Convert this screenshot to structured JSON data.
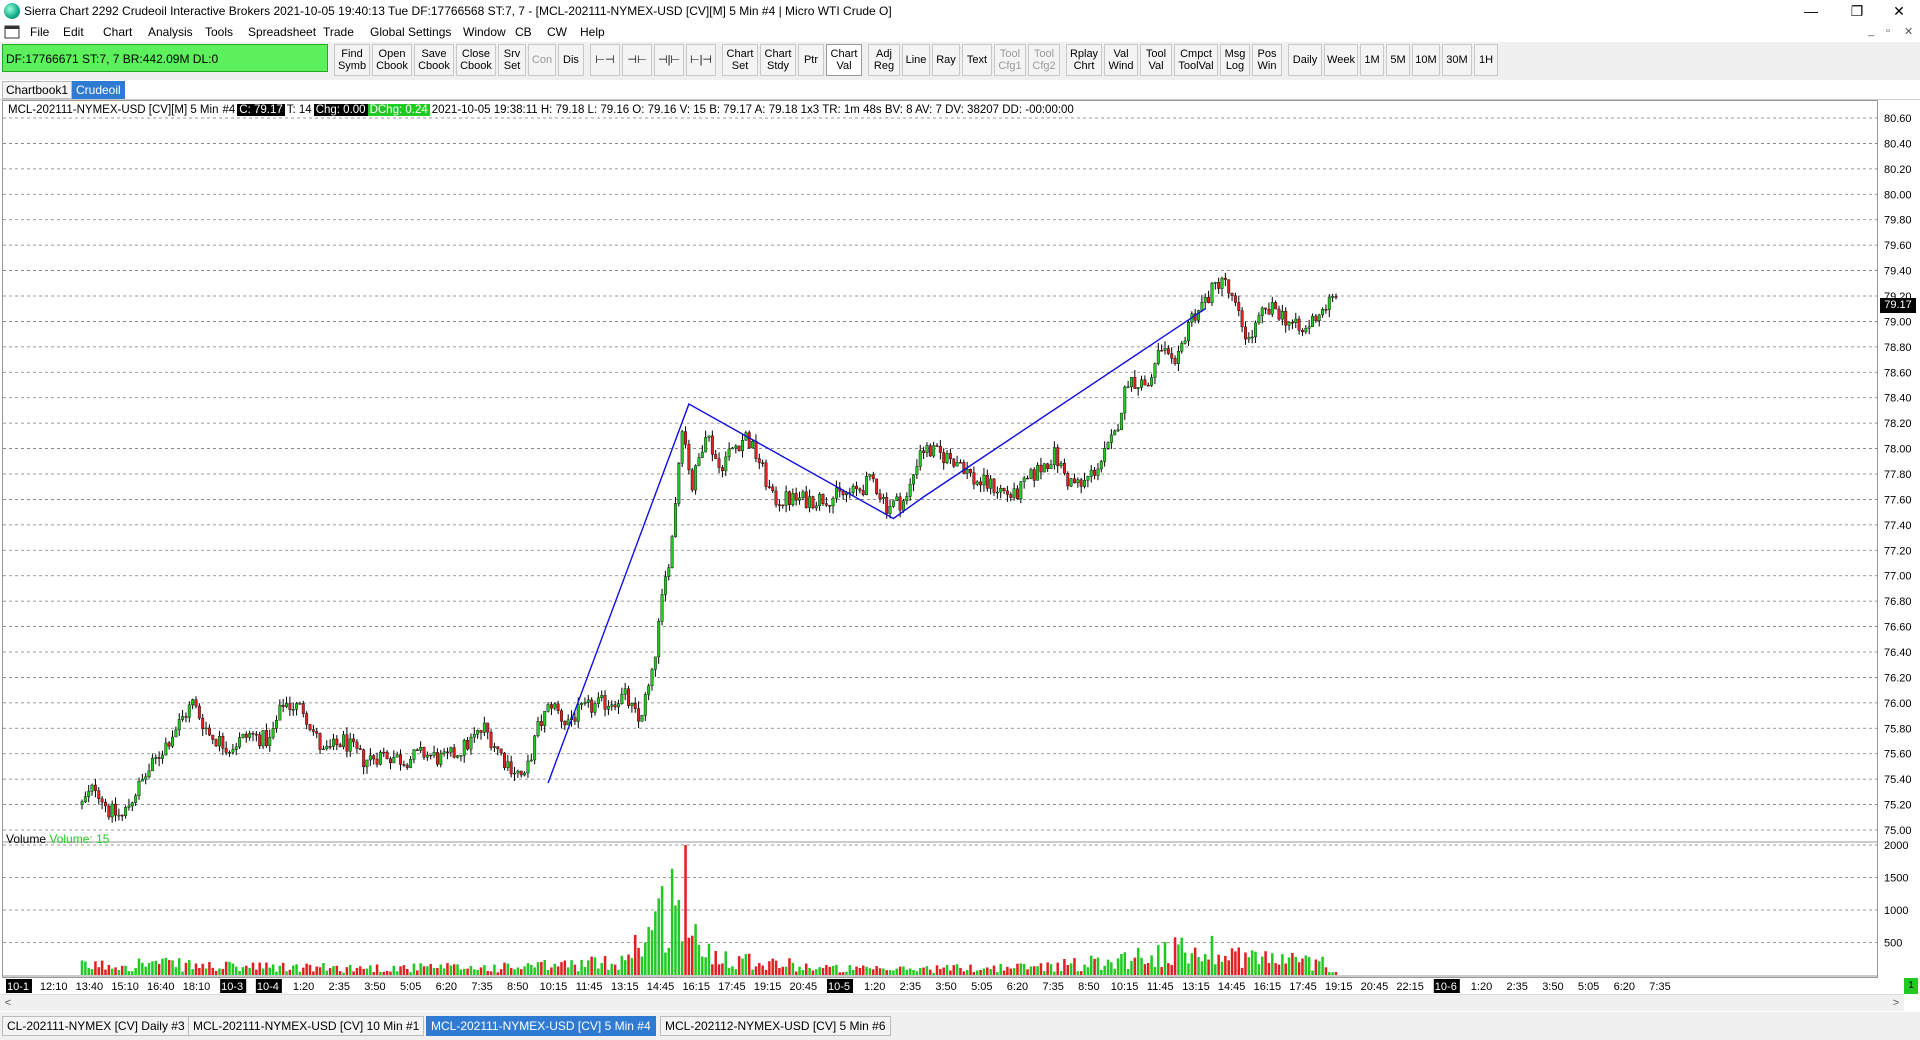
{
  "window": {
    "title": "Sierra Chart 2292 Crudeoil  Interactive Brokers 2021-10-05  19:40:13 Tue  DF:17766568  ST:7, 7 - [MCL-202111-NYMEX-USD [CV][M]  5 Min  #4 | Micro WTI Crude O]",
    "min": "—",
    "restore": "❐",
    "close": "✕"
  },
  "menu": [
    "File",
    "Edit",
    "Chart",
    "Analysis",
    "Tools",
    "Spreadsheet",
    "Trade",
    "Global Settings",
    "Window",
    "CB",
    "CW",
    "Help"
  ],
  "mdi_controls": [
    "_",
    "▫",
    "✕"
  ],
  "status": "DF:17766671  ST:7, 7  BR:442.09M  DL:0",
  "toolbar": [
    {
      "label": "Find\nSymb"
    },
    {
      "label": "Open\nCbook"
    },
    {
      "label": "Save\nCbook"
    },
    {
      "label": "Close\nCbook"
    },
    {
      "label": "Srv\nSet"
    },
    {
      "label": "Con",
      "disabled": true
    },
    {
      "label": "Dis"
    },
    {
      "label": "⊢⊣"
    },
    {
      "label": "⊣⊢"
    },
    {
      "label": "⊣|⊢"
    },
    {
      "label": "⊢|⊣"
    },
    {
      "label": "Chart\nSet"
    },
    {
      "label": "Chart\nStdy"
    },
    {
      "label": "Ptr"
    },
    {
      "label": "Chart\nVal",
      "pressed": true
    },
    {
      "label": "Adj\nReg"
    },
    {
      "label": "Line"
    },
    {
      "label": "Ray"
    },
    {
      "label": "Text"
    },
    {
      "label": "Tool\nCfg1",
      "disabled": true
    },
    {
      "label": "Tool\nCfg2",
      "disabled": true
    },
    {
      "label": "Rplay\nChrt"
    },
    {
      "label": "Val\nWind"
    },
    {
      "label": "Tool\nVal"
    },
    {
      "label": "Cmpct\nToolVal"
    },
    {
      "label": "Msg\nLog"
    },
    {
      "label": "Pos\nWin"
    },
    {
      "label": "Daily"
    },
    {
      "label": "Week"
    },
    {
      "label": "1M"
    },
    {
      "label": "5M"
    },
    {
      "label": "10M"
    },
    {
      "label": "30M"
    },
    {
      "label": "1H"
    }
  ],
  "chartbook_tabs": [
    {
      "label": "Chartbook1",
      "active": false
    },
    {
      "label": "Crudeoil",
      "active": true
    }
  ],
  "chart_header": {
    "symbol": "MCL-202111-NYMEX-USD [CV][M]  5 Min",
    "num": "#4",
    "close": "C: 79.17",
    "trades": "T: 14",
    "chg": "Chg: 0.00",
    "dchg": "DChg: 0.24",
    "rest": "2021-10-05 19:38:11  H: 79.18  L: 79.16  O: 79.16  V: 15  B: 79.17  A: 79.18  1x3  TR: 1m 48s  BV: 8  AV: 7  DV: 38207  DD: -00:00:00"
  },
  "volume_label": {
    "name": "Volume",
    "value": "Volume: 15"
  },
  "last_price": "79.17",
  "scroll_badge": "1",
  "bottom_tabs": [
    {
      "label": "CL-202111-NYMEX [CV]  Daily  #3",
      "active": false
    },
    {
      "label": "MCL-202111-NYMEX-USD [CV]  10 Min  #1",
      "active": false
    },
    {
      "label": "MCL-202111-NYMEX-USD [CV]  5 Min  #4",
      "active": true
    },
    {
      "label": "MCL-202112-NYMEX-USD [CV]  5 Min  #6",
      "active": false
    }
  ],
  "colors": {
    "up": "#22c922",
    "down": "#e02020",
    "wick": "#000000",
    "trendline": "#1010e0"
  },
  "chart_data": {
    "type": "candlestick",
    "price_axis": {
      "min": 75.0,
      "max": 80.6,
      "ticks": [
        "80.60",
        "80.40",
        "80.20",
        "80.00",
        "79.80",
        "79.60",
        "79.40",
        "79.20",
        "79.00",
        "78.80",
        "78.60",
        "78.40",
        "78.20",
        "78.00",
        "77.80",
        "77.60",
        "77.40",
        "77.20",
        "77.00",
        "76.80",
        "76.60",
        "76.40",
        "76.20",
        "76.00",
        "75.80",
        "75.60",
        "75.40",
        "75.20",
        "75.00"
      ]
    },
    "volume_axis": {
      "max": 2000,
      "ticks": [
        "2000",
        "1500",
        "1000",
        "500"
      ]
    },
    "time_ticks": [
      {
        "label": "10-1",
        "hl": true
      },
      {
        "label": "12:10"
      },
      {
        "label": "13:40"
      },
      {
        "label": "15:10"
      },
      {
        "label": "16:40"
      },
      {
        "label": "18:10"
      },
      {
        "label": "10-3",
        "hl": true
      },
      {
        "label": "10-4",
        "hl": true
      },
      {
        "label": "1:20"
      },
      {
        "label": "2:35"
      },
      {
        "label": "3:50"
      },
      {
        "label": "5:05"
      },
      {
        "label": "6:20"
      },
      {
        "label": "7:35"
      },
      {
        "label": "8:50"
      },
      {
        "label": "10:15"
      },
      {
        "label": "11:45"
      },
      {
        "label": "13:15"
      },
      {
        "label": "14:45"
      },
      {
        "label": "16:15"
      },
      {
        "label": "17:45"
      },
      {
        "label": "19:15"
      },
      {
        "label": "20:45"
      },
      {
        "label": "10-5",
        "hl": true
      },
      {
        "label": "1:20"
      },
      {
        "label": "2:35"
      },
      {
        "label": "3:50"
      },
      {
        "label": "5:05"
      },
      {
        "label": "6:20"
      },
      {
        "label": "7:35"
      },
      {
        "label": "8:50"
      },
      {
        "label": "10:15"
      },
      {
        "label": "11:45"
      },
      {
        "label": "13:15"
      },
      {
        "label": "14:45"
      },
      {
        "label": "16:15"
      },
      {
        "label": "17:45"
      },
      {
        "label": "19:15"
      },
      {
        "label": "20:45"
      },
      {
        "label": "22:15"
      },
      {
        "label": "10-6",
        "hl": true
      },
      {
        "label": "1:20"
      },
      {
        "label": "2:35"
      },
      {
        "label": "3:50"
      },
      {
        "label": "5:05"
      },
      {
        "label": "6:20"
      },
      {
        "label": "7:35"
      }
    ],
    "anchors": [
      {
        "i": 0,
        "p": 75.2
      },
      {
        "i": 4,
        "p": 75.35
      },
      {
        "i": 8,
        "p": 75.15
      },
      {
        "i": 12,
        "p": 75.1
      },
      {
        "i": 16,
        "p": 75.3
      },
      {
        "i": 22,
        "p": 75.55
      },
      {
        "i": 28,
        "p": 75.8
      },
      {
        "i": 33,
        "p": 76.0
      },
      {
        "i": 38,
        "p": 75.75
      },
      {
        "i": 44,
        "p": 75.65
      },
      {
        "i": 50,
        "p": 75.75
      },
      {
        "i": 56,
        "p": 75.7
      },
      {
        "i": 60,
        "p": 76.0
      },
      {
        "i": 66,
        "p": 75.95
      },
      {
        "i": 72,
        "p": 75.6
      },
      {
        "i": 78,
        "p": 75.7
      },
      {
        "i": 84,
        "p": 75.55
      },
      {
        "i": 90,
        "p": 75.6
      },
      {
        "i": 96,
        "p": 75.55
      },
      {
        "i": 102,
        "p": 75.6
      },
      {
        "i": 108,
        "p": 75.55
      },
      {
        "i": 114,
        "p": 75.65
      },
      {
        "i": 120,
        "p": 75.8
      },
      {
        "i": 126,
        "p": 75.55
      },
      {
        "i": 132,
        "p": 75.4
      },
      {
        "i": 136,
        "p": 75.8
      },
      {
        "i": 140,
        "p": 76.0
      },
      {
        "i": 144,
        "p": 75.85
      },
      {
        "i": 150,
        "p": 75.95
      },
      {
        "i": 156,
        "p": 76.0
      },
      {
        "i": 162,
        "p": 76.05
      },
      {
        "i": 166,
        "p": 75.85
      },
      {
        "i": 170,
        "p": 76.2
      },
      {
        "i": 173,
        "p": 76.8
      },
      {
        "i": 176,
        "p": 77.3
      },
      {
        "i": 179,
        "p": 78.2
      },
      {
        "i": 182,
        "p": 77.7
      },
      {
        "i": 186,
        "p": 78.15
      },
      {
        "i": 190,
        "p": 77.85
      },
      {
        "i": 194,
        "p": 78.0
      },
      {
        "i": 198,
        "p": 78.1
      },
      {
        "i": 202,
        "p": 77.9
      },
      {
        "i": 206,
        "p": 77.6
      },
      {
        "i": 212,
        "p": 77.6
      },
      {
        "i": 218,
        "p": 77.6
      },
      {
        "i": 224,
        "p": 77.62
      },
      {
        "i": 230,
        "p": 77.65
      },
      {
        "i": 236,
        "p": 77.75
      },
      {
        "i": 240,
        "p": 77.55
      },
      {
        "i": 246,
        "p": 77.6
      },
      {
        "i": 250,
        "p": 78.0
      },
      {
        "i": 256,
        "p": 77.95
      },
      {
        "i": 262,
        "p": 77.9
      },
      {
        "i": 266,
        "p": 77.75
      },
      {
        "i": 272,
        "p": 77.7
      },
      {
        "i": 278,
        "p": 77.62
      },
      {
        "i": 284,
        "p": 77.8
      },
      {
        "i": 290,
        "p": 77.95
      },
      {
        "i": 294,
        "p": 77.75
      },
      {
        "i": 298,
        "p": 77.7
      },
      {
        "i": 304,
        "p": 77.9
      },
      {
        "i": 308,
        "p": 78.1
      },
      {
        "i": 312,
        "p": 78.55
      },
      {
        "i": 318,
        "p": 78.5
      },
      {
        "i": 322,
        "p": 78.8
      },
      {
        "i": 326,
        "p": 78.6
      },
      {
        "i": 330,
        "p": 79.0
      },
      {
        "i": 336,
        "p": 79.2
      },
      {
        "i": 340,
        "p": 79.35
      },
      {
        "i": 344,
        "p": 79.1
      },
      {
        "i": 348,
        "p": 78.85
      },
      {
        "i": 352,
        "p": 79.05
      },
      {
        "i": 356,
        "p": 79.1
      },
      {
        "i": 360,
        "p": 79.0
      },
      {
        "i": 364,
        "p": 78.9
      },
      {
        "i": 368,
        "p": 79.05
      },
      {
        "i": 372,
        "p": 79.15
      },
      {
        "i": 374,
        "p": 79.17
      }
    ],
    "volume_profile": [
      {
        "i": 0,
        "v": 150
      },
      {
        "i": 20,
        "v": 200
      },
      {
        "i": 40,
        "v": 140
      },
      {
        "i": 80,
        "v": 120
      },
      {
        "i": 130,
        "v": 130
      },
      {
        "i": 160,
        "v": 220
      },
      {
        "i": 172,
        "v": 900
      },
      {
        "i": 176,
        "v": 1300
      },
      {
        "i": 180,
        "v": 700
      },
      {
        "i": 186,
        "v": 400
      },
      {
        "i": 200,
        "v": 250
      },
      {
        "i": 220,
        "v": 120
      },
      {
        "i": 240,
        "v": 90
      },
      {
        "i": 250,
        "v": 110
      },
      {
        "i": 280,
        "v": 130
      },
      {
        "i": 300,
        "v": 200
      },
      {
        "i": 320,
        "v": 350
      },
      {
        "i": 336,
        "v": 450
      },
      {
        "i": 350,
        "v": 300
      },
      {
        "i": 370,
        "v": 200
      },
      {
        "i": 374,
        "v": 80
      }
    ],
    "volume_spike": {
      "i": 180,
      "v": 2000
    },
    "trendlines": [
      [
        {
          "i": 139,
          "p": 75.37
        },
        {
          "i": 181,
          "p": 78.35
        },
        {
          "i": 242,
          "p": 77.45
        },
        {
          "i": 251,
          "p": 77.62
        },
        {
          "i": 335,
          "p": 79.1
        }
      ]
    ],
    "bars": 375
  }
}
